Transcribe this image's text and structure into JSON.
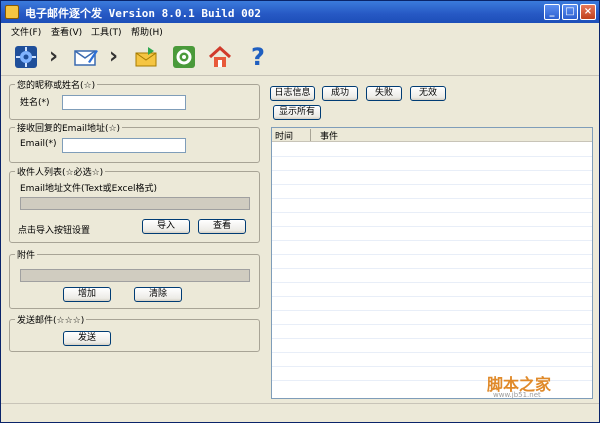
{
  "window": {
    "title": "电子邮件逐个发 Version 8.0.1 Build 002"
  },
  "menu": {
    "items": [
      "文件(F)",
      "查看(V)",
      "工具(T)",
      "帮助(H)"
    ]
  },
  "toolbar": {
    "icons": [
      "settings-gear-icon",
      "compose-mail-icon",
      "send-mail-icon",
      "options-icon",
      "home-icon",
      "help-icon"
    ],
    "help_glyph": "?"
  },
  "form": {
    "nickname": {
      "title": "您的昵称或姓名(☆)",
      "label": "姓名(*)",
      "value": ""
    },
    "reply": {
      "title": "接收回复的Email地址(☆)",
      "label": "Email(*)",
      "value": ""
    },
    "recipients": {
      "title": "收件人列表(☆必选☆)",
      "file_label": "Email地址文件(Text或Excel格式)",
      "hint": "点击导入按钮设置",
      "import_label": "导入",
      "view_label": "查看"
    },
    "attachment": {
      "title": "附件",
      "add_label": "增加",
      "clear_label": "清除"
    },
    "send": {
      "title": "发送邮件(☆☆☆)",
      "send_label": "发送"
    }
  },
  "log": {
    "filters": [
      "日志信息",
      "成功",
      "失败",
      "无效"
    ],
    "show_all_label": "显示所有",
    "columns": [
      "时间",
      "事件"
    ]
  },
  "watermark": {
    "brand": "脚本之家",
    "url": "www.jb51.net"
  }
}
